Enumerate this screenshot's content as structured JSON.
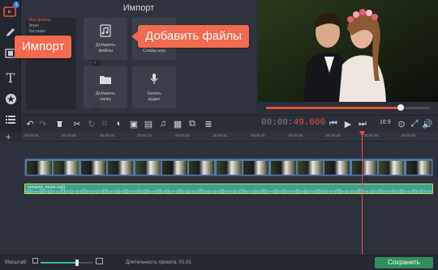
{
  "app": {
    "notification_badge": "1"
  },
  "import_panel": {
    "title": "Импорт",
    "categories": [
      "Мои файлы",
      "Звуки",
      "Заставки"
    ],
    "tiles": [
      {
        "label_line1": "Добавить",
        "label_line2": "файлы",
        "icon": "music-file-icon"
      },
      {
        "label_line1": "Слайд-шоу",
        "label_line2": "",
        "icon": "slideshow-icon"
      },
      {
        "label_line1": "Добавить",
        "label_line2": "папку",
        "icon": "folder-icon"
      },
      {
        "label_line1": "Запись",
        "label_line2": "аудио",
        "icon": "microphone-icon"
      }
    ],
    "collapse_arrow": "‹"
  },
  "callouts": {
    "import": "Импорт",
    "add_files": "Добавить файлы"
  },
  "preview": {
    "progress": 0.82
  },
  "toolbar": {
    "timecode_gray": "00:00:",
    "timecode_red": "49.600",
    "aspect_ratio": "16:9"
  },
  "timeline": {
    "ruler_labels": [
      "00:00:00",
      "00:00:05",
      "00:00:10",
      "00:00:15",
      "00:00:20",
      "00:00:25",
      "00:00:30",
      "00:00:35",
      "00:00:40",
      "00:00:45",
      "00:00:50",
      "00:00:55"
    ],
    "audio_clip_name": "romantic_music.mp3",
    "video_thumb_count": 15
  },
  "bottom_bar": {
    "scale_label": "Масштаб:",
    "zoom_level": 0.7,
    "duration_label": "Длительность проекта:",
    "duration_value": "01:01",
    "save_button": "Сохранить"
  },
  "colors": {
    "accent": "#e0533f",
    "callout": "#f26a4f",
    "audio_track": "#3d9f8e",
    "video_track": "#5b78a8",
    "save_button": "#2f8f5f"
  }
}
